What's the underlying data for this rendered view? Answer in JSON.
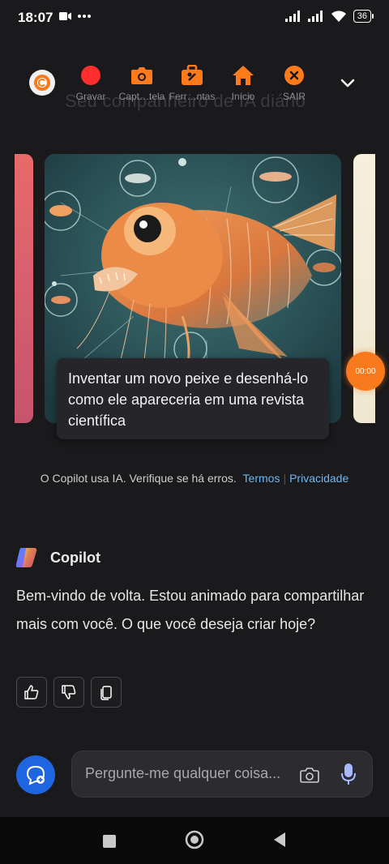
{
  "status_bar": {
    "time": "18:07",
    "battery": "36",
    "icons": [
      "video-icon",
      "more-dots-icon",
      "signal-icon",
      "signal-icon",
      "wifi-icon",
      "battery-icon"
    ]
  },
  "recorder_toolbar": {
    "items": [
      {
        "label": "Gravar",
        "icon": "record-icon",
        "color": "#ff2d2d"
      },
      {
        "label": "Capt…tela",
        "icon": "camera-icon",
        "color": "#ff7a1a"
      },
      {
        "label": "Ferr…ntas",
        "icon": "toolbox-icon",
        "color": "#ff7a1a"
      },
      {
        "label": "Início",
        "icon": "home-icon",
        "color": "#ff7a1a"
      },
      {
        "label": "SAIR",
        "icon": "close-circle-icon",
        "color": "#ff7a1a"
      }
    ],
    "timer": "00:00"
  },
  "background_title": "Seu companheiro de IA diário",
  "carousel": {
    "main_caption": "Inventar um novo peixe e desenhá-lo como ele apareceria em uma revista científica"
  },
  "disclaimer": {
    "text": "O Copilot usa IA. Verifique se há erros.",
    "terms": "Termos",
    "privacy": "Privacidade",
    "link_color": "#6fb7f0"
  },
  "message": {
    "sender": "Copilot",
    "text": "Bem-vindo de volta. Estou animado para compartilhar mais com você. O que você deseja criar hoje?"
  },
  "composer": {
    "placeholder": "Pergunte-me qualquer coisa...",
    "accent": "#1f64e0"
  },
  "nav": [
    "recents-square-icon",
    "home-circle-icon",
    "back-triangle-icon"
  ]
}
